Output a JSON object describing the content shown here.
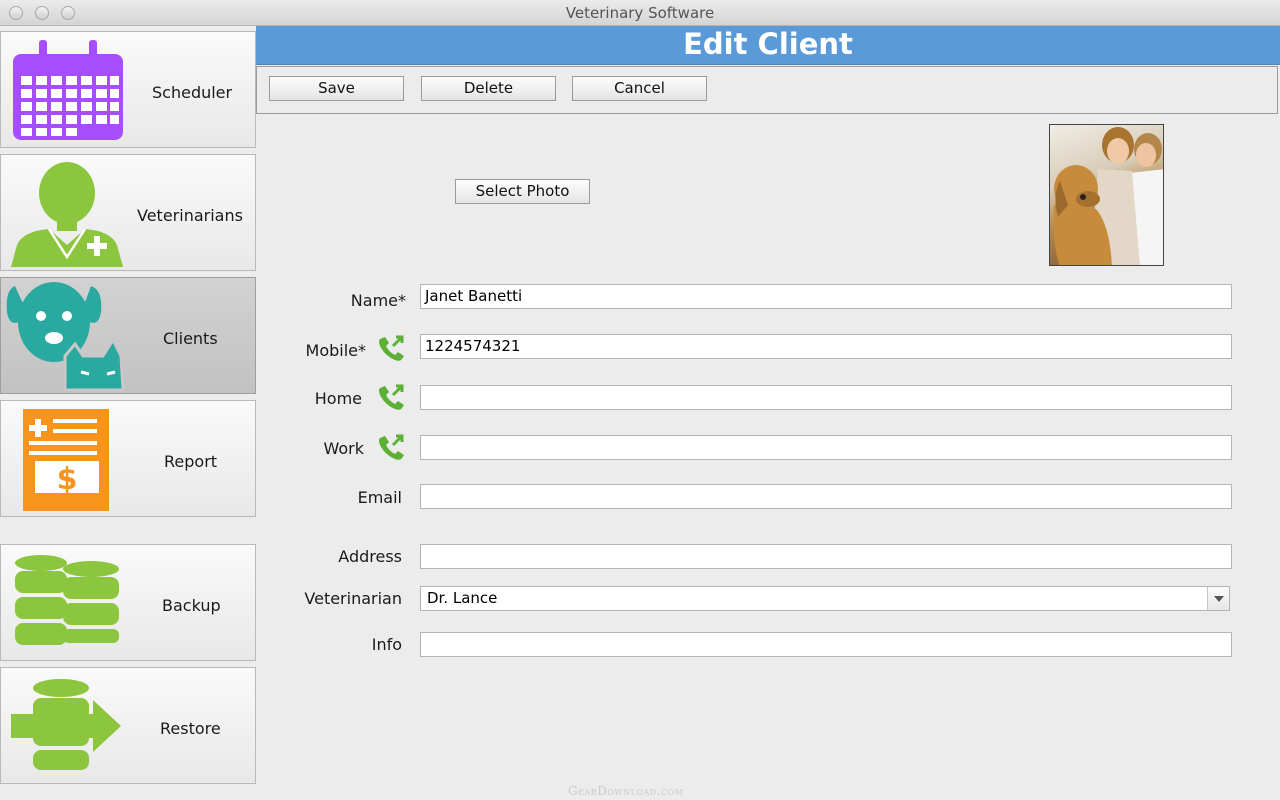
{
  "window": {
    "title": "Veterinary Software"
  },
  "sidebar": {
    "items": [
      {
        "label": "Scheduler",
        "icon": "calendar-icon"
      },
      {
        "label": "Veterinarians",
        "icon": "veterinarian-icon"
      },
      {
        "label": "Clients",
        "icon": "dog-cat-icon",
        "active": true
      },
      {
        "label": "Report",
        "icon": "invoice-icon"
      },
      {
        "label": "Backup",
        "icon": "database-icon"
      },
      {
        "label": "Restore",
        "icon": "database-restore-icon"
      }
    ]
  },
  "header": {
    "title": "Edit Client"
  },
  "toolbar": {
    "save": "Save",
    "delete": "Delete",
    "cancel": "Cancel"
  },
  "photo": {
    "select_label": "Select Photo"
  },
  "form": {
    "name": {
      "label": "Name*",
      "value": "Janet Banetti"
    },
    "mobile": {
      "label": "Mobile*",
      "value": "1224574321"
    },
    "home": {
      "label": "Home",
      "value": ""
    },
    "work": {
      "label": "Work",
      "value": ""
    },
    "email": {
      "label": "Email",
      "value": ""
    },
    "address": {
      "label": "Address",
      "value": ""
    },
    "veterinarian": {
      "label": "Veterinarian",
      "value": "Dr. Lance"
    },
    "info": {
      "label": "Info",
      "value": ""
    }
  },
  "watermark": "GearDownload.com",
  "colors": {
    "header": "#5a9ad8",
    "scheduler_icon": "#a64dff",
    "vet_icon": "#8cc63f",
    "clients_icon": "#2aa9a0",
    "report_icon": "#f7941d",
    "backup_icon": "#8cc63f"
  }
}
